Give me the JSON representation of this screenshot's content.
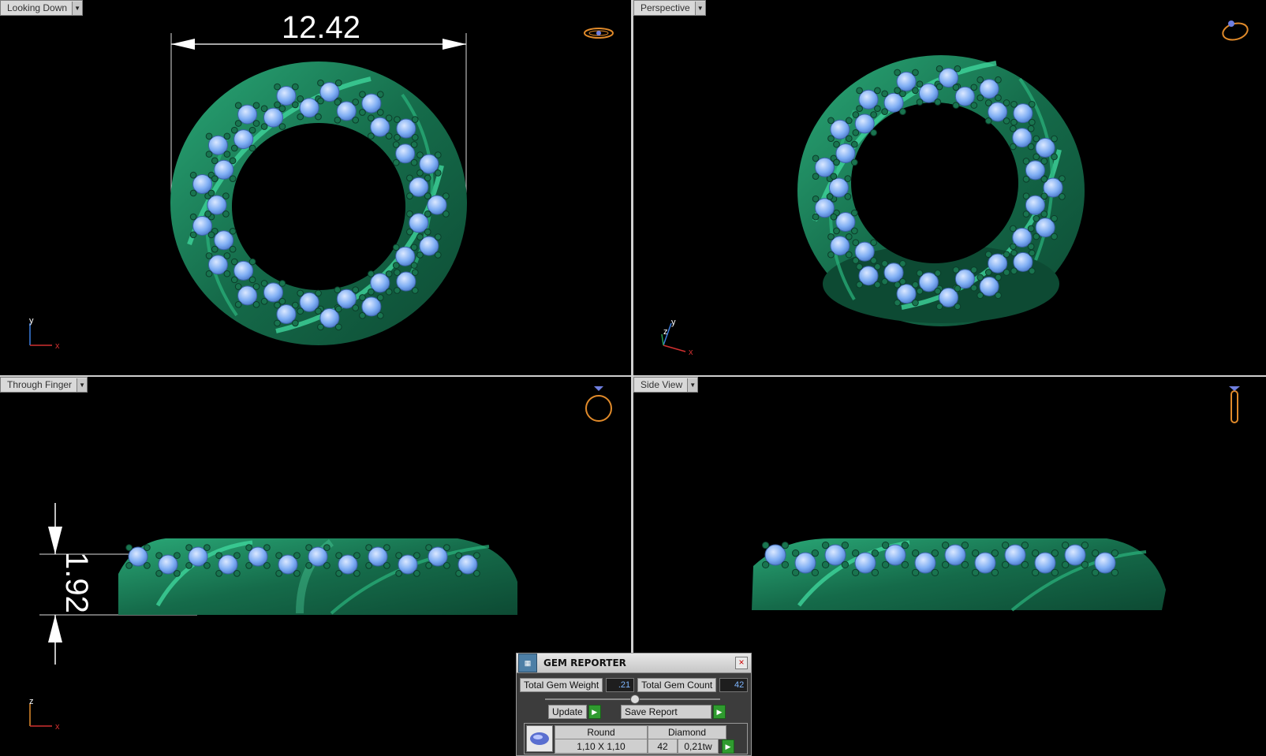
{
  "viewports": {
    "top_left": {
      "label": "Looking Down"
    },
    "top_right": {
      "label": "Perspective"
    },
    "bottom_left": {
      "label": "Through Finger"
    },
    "bottom_right": {
      "label": "Side View"
    }
  },
  "dimensions": {
    "width": "12.42",
    "height": "1.92"
  },
  "axes": {
    "looking_down": {
      "vertical": "y",
      "horizontal": "x"
    },
    "perspective": {
      "vertical": "y",
      "depth": "z",
      "horizontal": "x"
    },
    "through_finger": {
      "vertical": "z",
      "horizontal": "x"
    }
  },
  "gem_reporter": {
    "title": "GEM REPORTER",
    "total_weight_label": "Total Gem Weight",
    "total_weight_value": ".21",
    "total_count_label": "Total Gem Count",
    "total_count_value": "42",
    "update_label": "Update",
    "save_report_label": "Save Report",
    "table": {
      "shape_header": "Round",
      "material_header": "Diamond",
      "size": "1,10 X 1,10",
      "count": "42",
      "weight": "0,21tw"
    }
  },
  "colors": {
    "metal": "#1f8a5f",
    "metal_highlight": "#4fd39a",
    "gem": "#7faef4",
    "gem_light": "#c9ddff",
    "background": "#000000",
    "nav_icon": "#e08a2a"
  },
  "icons": {
    "dropdown": "chevron-down",
    "close": "close-x"
  }
}
